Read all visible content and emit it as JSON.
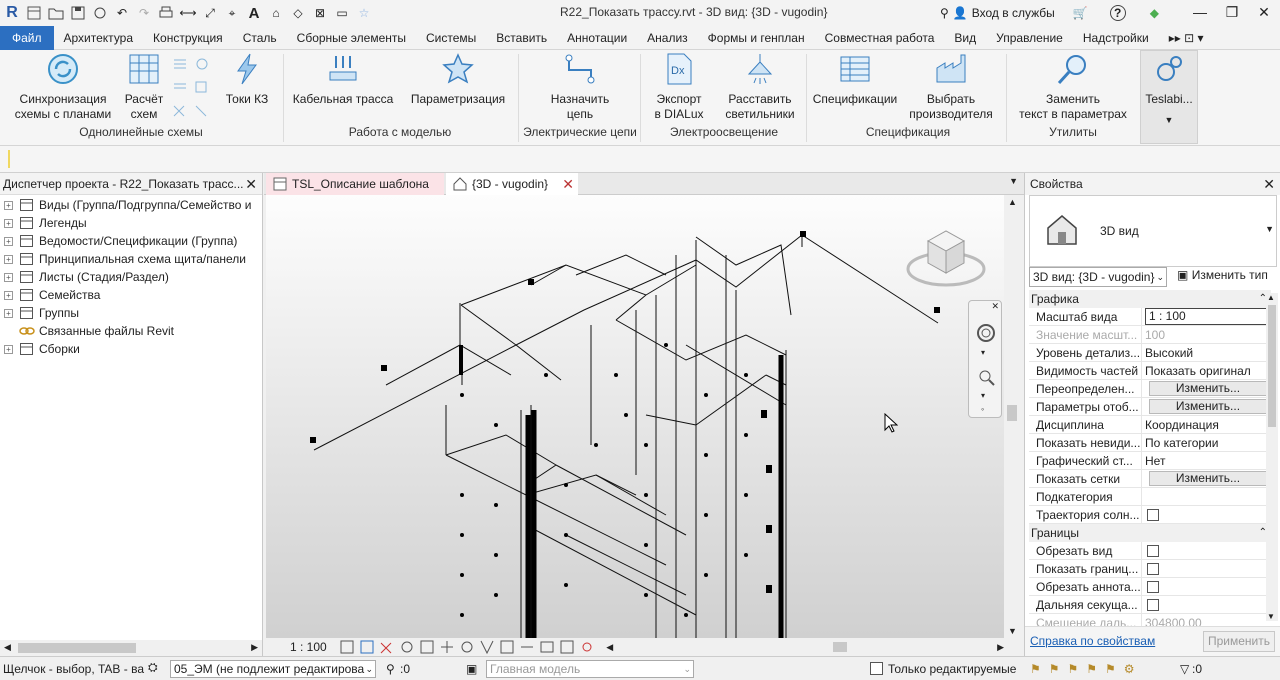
{
  "titlebar": {
    "app_logo": "R",
    "document_title": "R22_Показать трассу.rvt - 3D вид: {3D - vugodin}",
    "sign_in": "Вход в службы",
    "help": "?",
    "quick_access_icons": [
      "open-icon",
      "save-icon",
      "sync-icon",
      "undo-icon",
      "redo-icon",
      "print-icon",
      "measure-icon",
      "dimension-icon",
      "text-icon",
      "3d-view-icon",
      "close-hidden-icon",
      "switch-windows-icon"
    ]
  },
  "menu": {
    "tabs": [
      "Файл",
      "Архитектура",
      "Конструкция",
      "Сталь",
      "Сборные элементы",
      "Системы",
      "Вставить",
      "Аннотации",
      "Анализ",
      "Формы и генплан",
      "Совместная работа",
      "Вид",
      "Управление",
      "Надстройки"
    ]
  },
  "ribbon": {
    "buttons": {
      "sync": "Синхронизация\nсхемы с планами",
      "calc": "Расчёт\nсхем",
      "short_circuit": "Токи КЗ",
      "cable_tray": "Кабельная трасса",
      "parametrize": "Параметризация",
      "assign_circuit": "Назначить\nцепь",
      "export_dialux": "Экспорт\nв DIALux",
      "place_lights": "Расставить\nсветильники",
      "specs": "Спецификации",
      "choose_maker": "Выбрать\nпроизводителя",
      "replace_text": "Заменить\nтекст в параметрах",
      "teslabim": "Teslabi..."
    },
    "groups": {
      "single_line": "Однолинейные схемы",
      "model_work": "Работа с моделью",
      "circuits": "Электрические цепи",
      "lighting": "Электроосвещение",
      "specs": "Спецификация",
      "utils": "Утилиты"
    }
  },
  "browser": {
    "title": "Диспетчер проекта - R22_Показать трасс...",
    "items": [
      {
        "label": "Виды (Группа/Подгруппа/Семейство и"
      },
      {
        "label": "Легенды"
      },
      {
        "label": "Ведомости/Спецификации (Группа)"
      },
      {
        "label": "Принципиальная схема щита/панели"
      },
      {
        "label": "Листы (Стадия/Раздел)"
      },
      {
        "label": "Семейства"
      },
      {
        "label": "Группы"
      },
      {
        "label": "Связанные файлы Revit"
      },
      {
        "label": "Сборки"
      }
    ]
  },
  "view_tabs": {
    "tab1": "TSL_Описание шаблона",
    "tab2": "{3D - vugodin}"
  },
  "viewbar": {
    "scale": "1 : 100"
  },
  "properties": {
    "title": "Свойства",
    "type_name": "3D вид",
    "type_selector": "3D вид: {3D - vugodin}",
    "edit_type": "Изменить тип",
    "group_graphics": "Графика",
    "group_bounds": "Границы",
    "rows": [
      {
        "name": "Масштаб вида",
        "value": "1 : 100"
      },
      {
        "name": "Значение масшт...",
        "value": "100"
      },
      {
        "name": "Уровень детализ...",
        "value": "Высокий"
      },
      {
        "name": "Видимость частей",
        "value": "Показать оригинал"
      },
      {
        "name": "Переопределен...",
        "value": "Изменить..."
      },
      {
        "name": "Параметры отоб...",
        "value": "Изменить..."
      },
      {
        "name": "Дисциплина",
        "value": "Координация"
      },
      {
        "name": "Показать невиди...",
        "value": "По категории"
      },
      {
        "name": "Графический ст...",
        "value": "Нет"
      },
      {
        "name": "Показать сетки",
        "value": "Изменить..."
      },
      {
        "name": "Подкатегория",
        "value": ""
      },
      {
        "name": "Траектория солн...",
        "value": ""
      },
      {
        "name": "Обрезать вид",
        "value": ""
      },
      {
        "name": "Показать границ...",
        "value": ""
      },
      {
        "name": "Обрезать аннота...",
        "value": ""
      },
      {
        "name": "Дальняя секуща...",
        "value": ""
      },
      {
        "name": "Смещение даль...",
        "value": "304800,00"
      }
    ],
    "help_link": "Справка по свойствам",
    "apply": "Применить"
  },
  "statusbar": {
    "hint": "Щелчок - выбор, TAB - ва",
    "workset": "05_ЭМ (не подлежит редактирова",
    "selected_count": ":0",
    "design_option": "Главная модель",
    "editable_only": "Только редактируемые",
    "filter_count": ":0"
  },
  "colors": {
    "accent": "#2c6fc1",
    "tab_pink": "#fbe3e7",
    "link": "#1a5fb4"
  }
}
